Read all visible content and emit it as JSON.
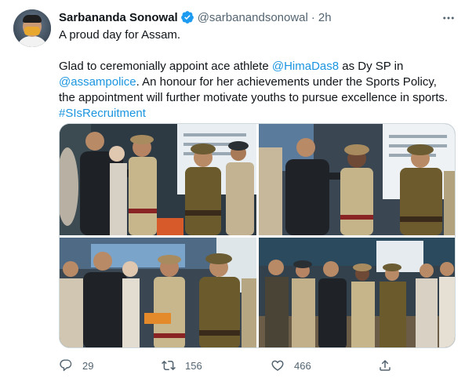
{
  "tweet": {
    "author_name": "Sarbananda Sonowal",
    "handle": "@sarbanandsonowal",
    "separator": "·",
    "time": "2h",
    "line1": "A proud day for Assam.",
    "line2_a": "Glad to ceremonially appoint ace athlete ",
    "mention_hima": "@HimaDas8",
    "line2_b": " as Dy SP in",
    "mention_police": "@assampolice",
    "line3_b": ".  An honour for her achievements under the Sports Policy,",
    "line4": "the appointment will further motivate youths to pursue excellence in sports.",
    "hashtag": "#SIsRecruitment"
  },
  "actions": {
    "replies": "29",
    "retweets": "156",
    "likes": "466"
  },
  "colors": {
    "link": "#1b95e0",
    "secondary_text": "#536471",
    "verified_badge": "#1d9bf0",
    "border": "#cfd9de"
  },
  "icons": {
    "verified": "verified-badge-icon",
    "more": "more-horizontal-icon",
    "reply": "reply-icon",
    "retweet": "retweet-icon",
    "like": "heart-icon",
    "share": "share-icon"
  }
}
